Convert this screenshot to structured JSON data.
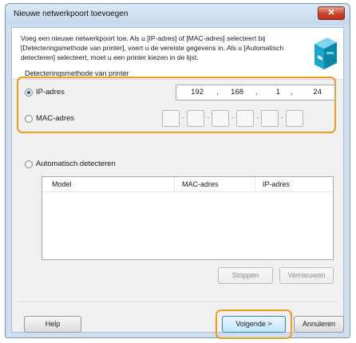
{
  "window": {
    "title": "Nieuwe netwerkpoort toevoegen",
    "close_label": "✕"
  },
  "intro": {
    "text": "Voeg een nieuwe netwerkpoort toe. Als u [IP-adres] of [MAC-adres] selecteert bij [Detecteringsmethode van printer], voert u de vereiste gegevens in. Als u [Automatisch detecteren] selecteert, moet u een printer kiezen in de lijst."
  },
  "detection": {
    "group_label": "Detecteringsmethode van printer",
    "ip_label": "IP-adres",
    "mac_label": "MAC-adres",
    "auto_label": "Automatisch detecteren",
    "selected": "ip",
    "ip_octets": [
      "192",
      "168",
      "1",
      "24"
    ]
  },
  "table": {
    "columns": [
      "Model",
      "MAC-adres",
      "IP-adres"
    ],
    "rows": []
  },
  "buttons": {
    "stop": "Stoppen",
    "refresh": "Vernieuwen",
    "help": "Help",
    "next": "Volgende >",
    "cancel": "Annuleren"
  },
  "colors": {
    "highlight": "#f09a1e",
    "titlebar": "#cfdff0",
    "close": "#c8442b"
  },
  "icons": {
    "printer": "printer-icon",
    "close": "close-icon"
  }
}
